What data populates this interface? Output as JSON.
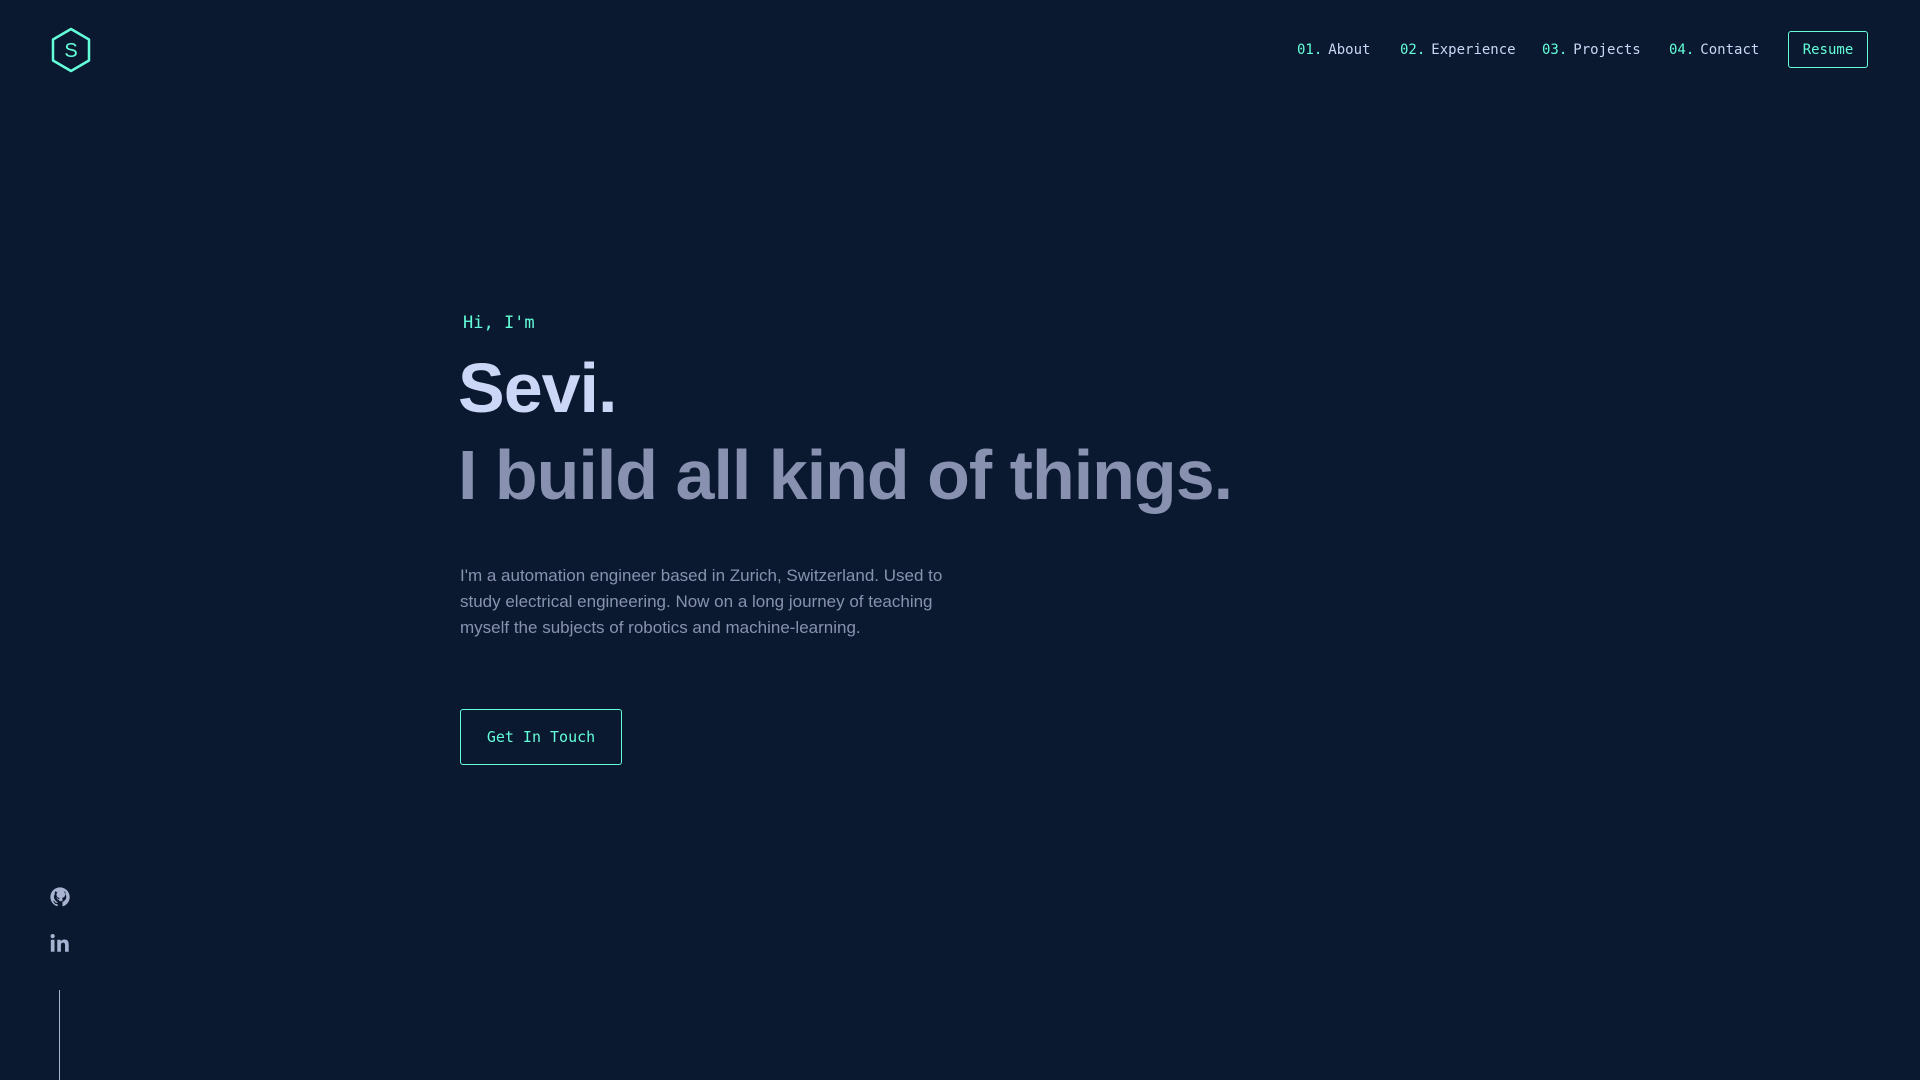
{
  "brand": {
    "logo_letter": "S",
    "accent_color": "#64ffda",
    "background_color": "#0a192f"
  },
  "nav": {
    "items": [
      {
        "num": "01.",
        "label": "About"
      },
      {
        "num": "02.",
        "label": "Experience"
      },
      {
        "num": "03.",
        "label": "Projects"
      },
      {
        "num": "04.",
        "label": "Contact"
      }
    ],
    "resume_label": "Resume"
  },
  "hero": {
    "greeting": "Hi, I'm",
    "name": "Sevi.",
    "tagline": "I build all kind of things.",
    "bio": "I'm a automation engineer based in Zurich, Switzerland. Used to study electrical engineering. Now on a long journey of teaching myself the subjects of robotics and machine-learning.",
    "cta_label": "Get In Touch"
  },
  "social": {
    "icons": [
      "github-icon",
      "linkedin-icon"
    ]
  }
}
